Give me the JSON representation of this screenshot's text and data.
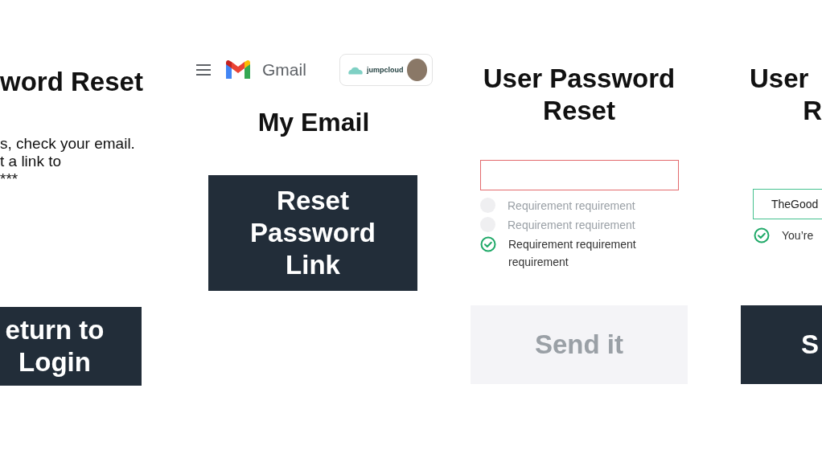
{
  "panels": [
    {
      "kind": "confirmation",
      "title": "word Reset",
      "message_lines": [
        "s, check your email.",
        "t a link to",
        "***"
      ],
      "button": {
        "label": "eturn to Login",
        "disabled": false
      }
    },
    {
      "kind": "email",
      "app_name": "Gmail",
      "brand": "jumpcloud",
      "heading": "My Email",
      "button": {
        "label": "Reset Password Link",
        "disabled": false
      }
    },
    {
      "kind": "form",
      "title_lines": [
        "User Password",
        "Reset"
      ],
      "field": {
        "invalid": true,
        "valid": false
      },
      "requirements": [
        {
          "text": "Requirement requirement",
          "met": false
        },
        {
          "text": "Requirement requirement",
          "met": false
        },
        {
          "text": "Requirement requirement requirement",
          "met": true
        }
      ],
      "button": {
        "label": "Send it",
        "disabled": true
      }
    },
    {
      "kind": "form",
      "title_lines": [
        "User",
        "R"
      ],
      "field": {
        "value": "TheGood",
        "invalid": false,
        "valid": true
      },
      "requirements": [
        {
          "text": "You’re",
          "met": true
        }
      ],
      "button": {
        "label": "S",
        "disabled": false
      }
    }
  ]
}
